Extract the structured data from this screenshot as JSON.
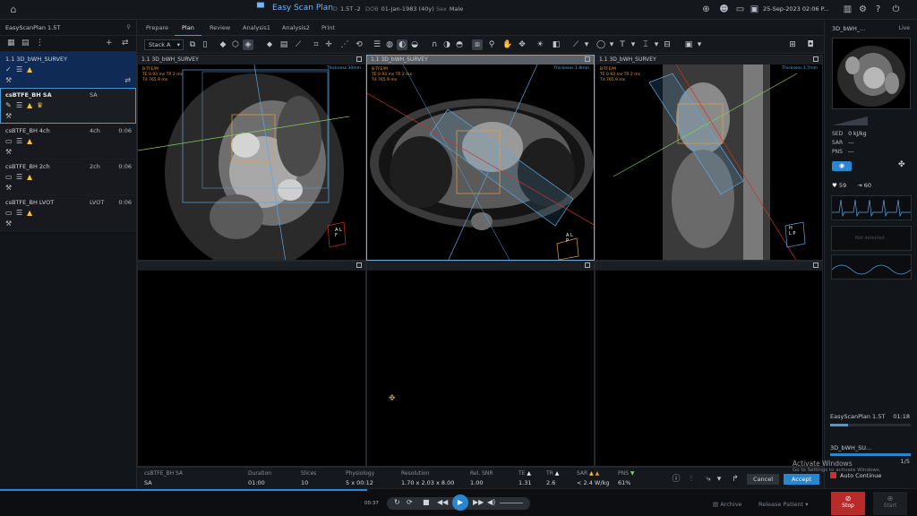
{
  "colors": {
    "accent": "#2a86cf",
    "warning": "#f2c230",
    "stop": "#b92b2b",
    "overlay": "#5aa8e0",
    "info": "#e59a3c"
  },
  "topbar": {
    "app_title": "Easy Scan Plan",
    "scanner_label": "ID",
    "scanner": "1.5T -2",
    "dob_label": "DOB",
    "dob": "01-Jan-1983 (40y)",
    "sex_label": "Sex",
    "sex": "Male",
    "datetime": "25-Sep-2023  02:06 P..."
  },
  "left_panel": {
    "title": "EasyScanPlan 1.5T",
    "scans": [
      {
        "name": "1.1 3D_bWH_SURVEY",
        "tag": "",
        "duration": ""
      },
      {
        "name": "csBTFE_BH SA",
        "tag": "SA",
        "duration": ""
      },
      {
        "name": "csBTFE_BH 4ch",
        "tag": "4ch",
        "duration": "0:06"
      },
      {
        "name": "csBTFE_BH 2ch",
        "tag": "2ch",
        "duration": "0:06"
      },
      {
        "name": "csBTFE_BH LVOT",
        "tag": "LVOT",
        "duration": "0:06"
      }
    ]
  },
  "tabs": [
    "Prepare",
    "Plan",
    "Review",
    "Analysis1",
    "Analysis2",
    "Print"
  ],
  "toolbar": {
    "stack_value": "Stack A"
  },
  "viewports": [
    {
      "title": "1.1 3D_bWH_SURVEY",
      "thickness": "Thickness 30mm",
      "seq": "B-TFE/M",
      "te_tr": "TE 0.93 ms  TR 2 ms",
      "td": "Td 765.9 ms",
      "orient": [
        "A",
        "F",
        "L"
      ]
    },
    {
      "title": "1.1 3D_bWH_SURVEY",
      "thickness": "Thickness 1.8mm",
      "seq": "B-TFE/M",
      "te_tr": "TE 0.93 ms  TR 2 ms",
      "td": "Td 765.9 ms",
      "orient": [
        "A",
        "L",
        "P"
      ]
    },
    {
      "title": "1.1 3D_bWH_SURVEY",
      "thickness": "Thickness 1.7mm",
      "seq": "B-TFE/M",
      "te_tr": "TE 0.93 ms  TR 2 ms",
      "td": "Td 765.9 ms",
      "orient": [
        "H",
        "L",
        "P"
      ]
    }
  ],
  "right_panel": {
    "thumb_title": "3D_bWH_...",
    "live": "Live",
    "sed_label": "SED",
    "sed": "0 kJ/kg",
    "sar_label": "SAR",
    "sar": "---",
    "pns_label": "PNS",
    "pns": "---",
    "heart_rate": "59",
    "resp": "60",
    "resp_note": "Not detected",
    "plan_name": "EasyScanPlan 1.5T",
    "plan_time": "01:18",
    "plan_progress": 0.22,
    "current_scan": "3D_bWH_SU...",
    "scan_count": "1/5",
    "auto_continue": "Auto Continue"
  },
  "params": {
    "scan_name": "csBTFE_BH SA",
    "scan_tag": "SA",
    "cols": [
      {
        "label": "Duration",
        "value": "01:00"
      },
      {
        "label": "Slices",
        "value": "10"
      },
      {
        "label": "Physiology",
        "value": "5 x 00:12"
      },
      {
        "label": "Resolution",
        "value": "1.70 x 2.03 x 8.00"
      },
      {
        "label": "Rel. SNR",
        "value": "1.00"
      },
      {
        "label": "TE",
        "value": "1.31"
      },
      {
        "label": "TR",
        "value": "2.6"
      },
      {
        "label": "SAR",
        "value": "< 2.4 W/kg"
      },
      {
        "label": "PNS",
        "value": "61%"
      }
    ],
    "cancel": "Cancel",
    "accept": "Accept"
  },
  "transport": {
    "time": "00:37",
    "archive": "Archive",
    "release": "Release Patient",
    "stop": "Stop",
    "start": "Start"
  },
  "watermark": {
    "title": "Activate Windows",
    "sub": "Go to Settings to activate Windows."
  }
}
